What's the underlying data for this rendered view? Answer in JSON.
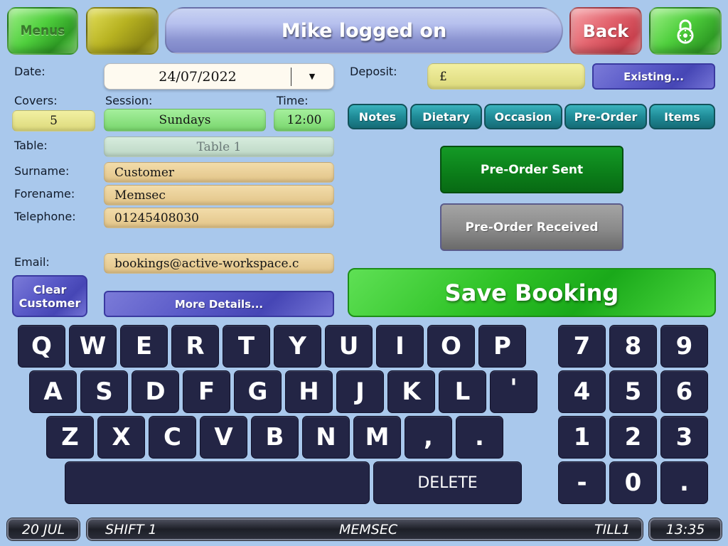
{
  "header": {
    "menus_label": "Menus",
    "title": "Mike logged on",
    "back_label": "Back"
  },
  "form": {
    "date_label": "Date:",
    "date_value": "24/07/2022",
    "covers_label": "Covers:",
    "covers_value": "5",
    "session_label": "Session:",
    "session_value": "Sundays",
    "time_label": "Time:",
    "time_value": "12:00",
    "table_label": "Table:",
    "table_value": "Table 1",
    "surname_label": "Surname:",
    "surname_value": "Customer",
    "forename_label": "Forename:",
    "forename_value": "Memsec",
    "telephone_label": "Telephone:",
    "telephone_value": "01245408030",
    "email_label": "Email:",
    "email_value": "bookings@active-workspace.c",
    "deposit_label": "Deposit:",
    "deposit_value": "£",
    "existing_label": "Existing...",
    "clear_customer_label": "Clear Customer",
    "more_details_label": "More Details..."
  },
  "tabs": [
    "Notes",
    "Dietary",
    "Occasion",
    "Pre-Order",
    "Items"
  ],
  "actions": {
    "preorder_sent": "Pre-Order Sent",
    "preorder_received": "Pre-Order Received",
    "save_booking": "Save Booking"
  },
  "keyboard": {
    "row1": [
      "Q",
      "W",
      "E",
      "R",
      "T",
      "Y",
      "U",
      "I",
      "O",
      "P"
    ],
    "row2": [
      "A",
      "S",
      "D",
      "F",
      "G",
      "H",
      "J",
      "K",
      "L",
      "'"
    ],
    "row3": [
      "Z",
      "X",
      "C",
      "V",
      "B",
      "N",
      "M",
      ",",
      "."
    ],
    "delete_label": "DELETE",
    "numpad": [
      "7",
      "8",
      "9",
      "4",
      "5",
      "6",
      "1",
      "2",
      "3",
      "-",
      "0",
      "."
    ]
  },
  "status_bar": {
    "date": "20 JUL",
    "shift": "SHIFT 1",
    "user": "MEMSEC",
    "till": "TILL1",
    "time": "13:35"
  },
  "icons": {
    "lock": "padlock-icon",
    "dropdown": "caret-down-icon"
  }
}
